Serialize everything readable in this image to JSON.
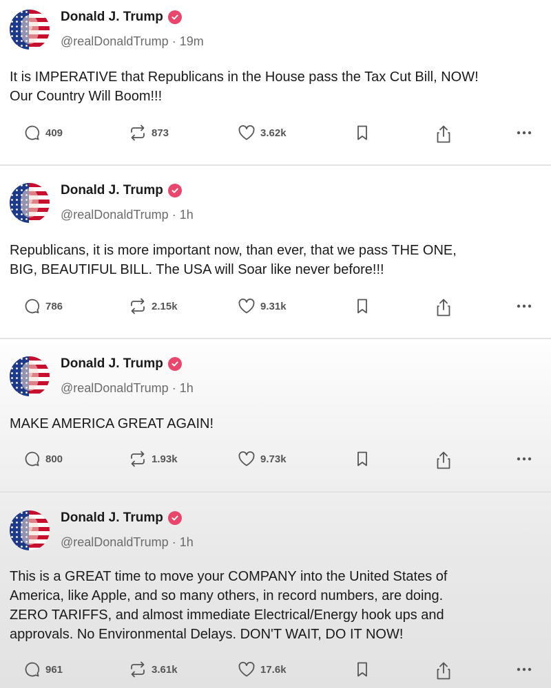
{
  "posts": [
    {
      "author": "Donald J. Trump",
      "handle": "@realDonaldTrump",
      "time": "19m",
      "text": "It is IMPERATIVE that Republicans in the House pass the Tax Cut Bill, NOW!\nOur Country Will Boom!!!",
      "replies": "409",
      "reposts": "873",
      "likes": "3.62k"
    },
    {
      "author": "Donald J. Trump",
      "handle": "@realDonaldTrump",
      "time": "1h",
      "text": "Republicans, it is more important now, than ever, that we pass THE ONE,\nBIG, BEAUTIFUL BILL. The USA will Soar like never before!!!",
      "replies": "786",
      "reposts": "2.15k",
      "likes": "9.31k"
    },
    {
      "author": "Donald J. Trump",
      "handle": "@realDonaldTrump",
      "time": "1h",
      "text": "MAKE AMERICA GREAT AGAIN!",
      "replies": "800",
      "reposts": "1.93k",
      "likes": "9.73k"
    },
    {
      "author": "Donald J. Trump",
      "handle": "@realDonaldTrump",
      "time": "1h",
      "text": "This is a GREAT time to move your COMPANY into the United States of\nAmerica, like Apple, and so many others, in record numbers, are doing.\nZERO TARIFFS, and almost immediate Electrical/Energy hook ups and\napprovals. No Environmental Delays. DON'T WAIT, DO IT NOW!",
      "replies": "961",
      "reposts": "3.61k",
      "likes": "17.6k"
    }
  ],
  "separator": "·",
  "icons": {
    "verified": "verified-badge-icon",
    "reply": "speech-bubble-icon",
    "repost": "repost-arrows-icon",
    "like": "heart-icon",
    "bookmark": "bookmark-icon",
    "share": "share-upload-icon",
    "more": "ellipsis-icon"
  },
  "colors": {
    "verified_badge": "#e8466a",
    "name": "#1a1a1a",
    "meta": "#6b6b6b",
    "action": "#555555"
  }
}
